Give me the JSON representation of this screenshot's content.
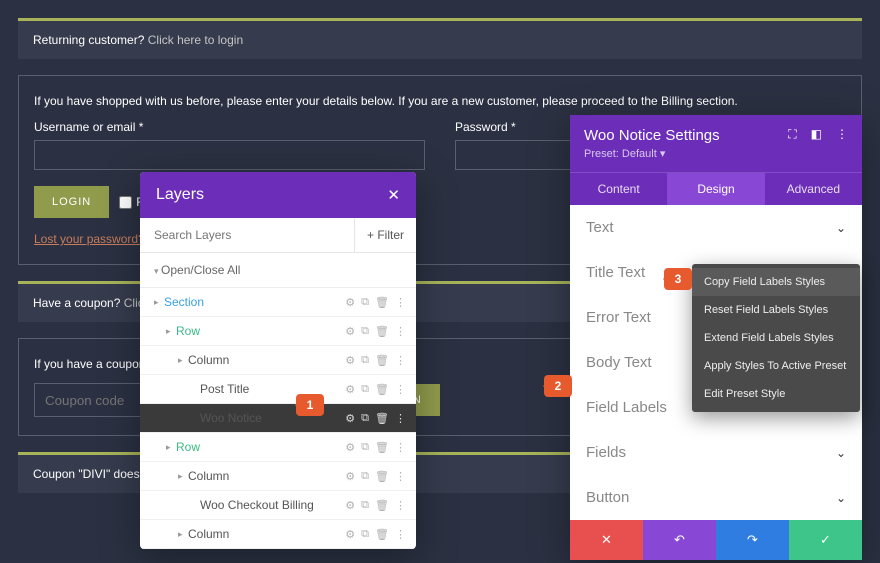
{
  "notices": {
    "returning": {
      "text": "Returning customer? ",
      "link": "Click here to login"
    },
    "shopped": "If you have shopped with us before, please enter your details below. If you are a new customer, please proceed to the Billing section.",
    "coupon_q": {
      "text": "Have a coupon? ",
      "link": "Click here to enter your code"
    },
    "coupon_help": "If you have a coupon code, please apply it below.",
    "coupon_err": "Coupon \"DIVI\" does not exist!"
  },
  "form": {
    "user_label": "Username or email *",
    "pass_label": "Password *",
    "login_btn": "LOGIN",
    "remember": "Remember me",
    "lost_pw": "Lost your password?",
    "coupon_ph": "Coupon code",
    "apply_btn": "APPLY COUPON"
  },
  "layers": {
    "title": "Layers",
    "search_ph": "Search Layers",
    "filter": "Filter",
    "toggle_all": "Open/Close All",
    "items": [
      {
        "label": "Section",
        "kind": "section",
        "indent": 0
      },
      {
        "label": "Row",
        "kind": "row",
        "indent": 1
      },
      {
        "label": "Column",
        "kind": "col",
        "indent": 2
      },
      {
        "label": "Post Title",
        "kind": "mod",
        "indent": 3
      },
      {
        "label": "Woo Notice",
        "kind": "mod",
        "indent": 3,
        "active": true
      },
      {
        "label": "Row",
        "kind": "row",
        "indent": 1
      },
      {
        "label": "Column",
        "kind": "col",
        "indent": 2
      },
      {
        "label": "Woo Checkout Billing",
        "kind": "mod",
        "indent": 3
      },
      {
        "label": "Column",
        "kind": "col",
        "indent": 2
      }
    ]
  },
  "settings": {
    "title": "Woo Notice Settings",
    "preset": "Preset: Default",
    "tabs": [
      {
        "label": "Content",
        "active": false
      },
      {
        "label": "Design",
        "active": true
      },
      {
        "label": "Advanced",
        "active": false
      }
    ],
    "sections": [
      "Text",
      "Title Text",
      "Error Text",
      "Body Text",
      "Field Labels",
      "Fields",
      "Button"
    ]
  },
  "ctx": {
    "items": [
      "Copy Field Labels Styles",
      "Reset Field Labels Styles",
      "Extend Field Labels Styles",
      "Apply Styles To Active Preset",
      "Edit Preset Style"
    ]
  },
  "badges": {
    "b1": "1",
    "b2": "2",
    "b3": "3"
  }
}
